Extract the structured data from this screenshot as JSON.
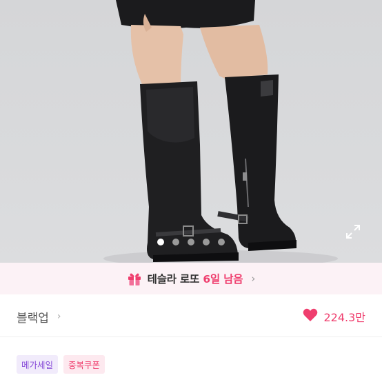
{
  "promo": {
    "prefix": "테슬라 로또",
    "highlight": "6일 남음",
    "icon": "gift-icon"
  },
  "carousel": {
    "total": 5,
    "active_index": 0
  },
  "store": {
    "name": "블랙업",
    "likes": "224.3만"
  },
  "tags": [
    "메가세일",
    "중복쿠폰"
  ],
  "colors": {
    "accent": "#ef3e6e",
    "promo_bg": "#fcf2f6",
    "tag_purple": "#8a4fd9"
  }
}
